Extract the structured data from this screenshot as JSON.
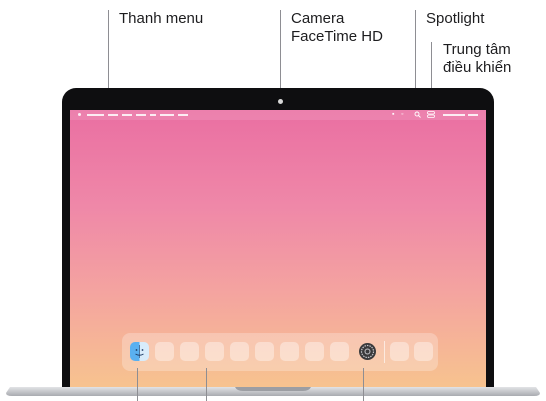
{
  "callouts": {
    "menu_bar": "Thanh menu",
    "camera_line1": "Camera",
    "camera_line2": "FaceTime HD",
    "spotlight": "Spotlight",
    "control_center_line1": "Trung tâm",
    "control_center_line2": "điều khiển"
  },
  "menubar_icons": [
    "battery-icon",
    "wifi-icon",
    "search-icon",
    "control-center-icon"
  ],
  "dock": {
    "apps": [
      "finder-icon",
      "app-tile",
      "app-tile",
      "app-tile",
      "app-tile",
      "app-tile",
      "app-tile",
      "app-tile",
      "app-tile",
      "system-settings-icon",
      "app-tile",
      "app-tile"
    ]
  },
  "colors": {
    "wallpaper_top": "#ea6fa2",
    "wallpaper_bottom": "#f7c38f",
    "bezel": "#0e0e10",
    "leader_line": "#8e8e93"
  }
}
